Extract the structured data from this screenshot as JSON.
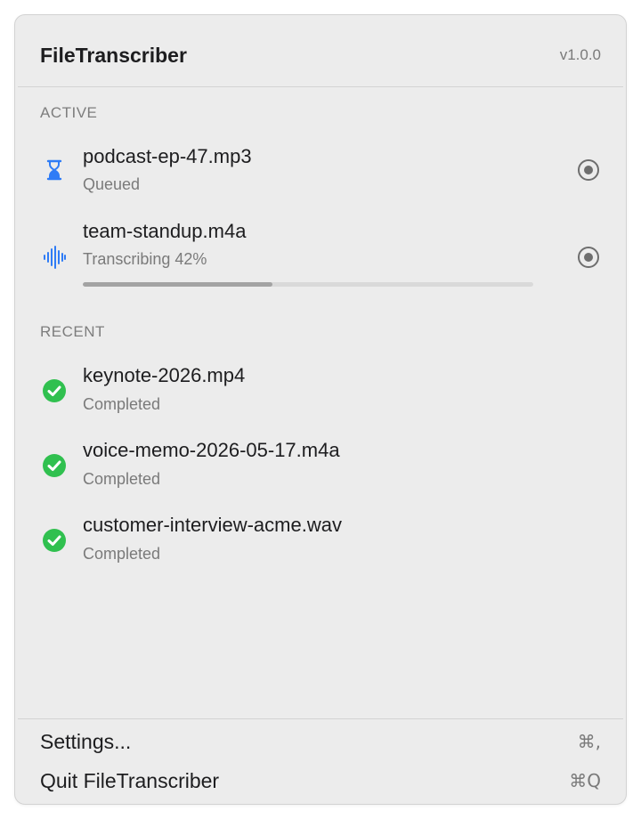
{
  "app": {
    "title": "FileTranscriber",
    "version": "v1.0.0"
  },
  "active": {
    "section_title": "ACTIVE",
    "items": [
      {
        "icon": "hourglass-icon",
        "file_name": "podcast-ep-47.mp3",
        "status": "Queued",
        "action_icon": "stop-circle-icon"
      },
      {
        "icon": "waveform-icon",
        "file_name": "team-standup.m4a",
        "status": "Transcribing 42%",
        "progress_percent": 42,
        "action_icon": "stop-circle-icon"
      }
    ]
  },
  "recent": {
    "section_title": "RECENT",
    "items": [
      {
        "icon": "checkmark-circle-icon",
        "file_name": "keynote-2026.mp4",
        "status": "Completed"
      },
      {
        "icon": "checkmark-circle-icon",
        "file_name": "voice-memo-2026-05-17.m4a",
        "status": "Completed"
      },
      {
        "icon": "checkmark-circle-icon",
        "file_name": "customer-interview-acme.wav",
        "status": "Completed"
      }
    ]
  },
  "menu": {
    "settings_label": "Settings...",
    "settings_shortcut": "⌘,",
    "quit_label": "Quit FileTranscriber",
    "quit_shortcut": "⌘Q"
  },
  "colors": {
    "accent_blue": "#2f7cf6",
    "success_green": "#30c04f",
    "panel_background": "#ececec"
  }
}
